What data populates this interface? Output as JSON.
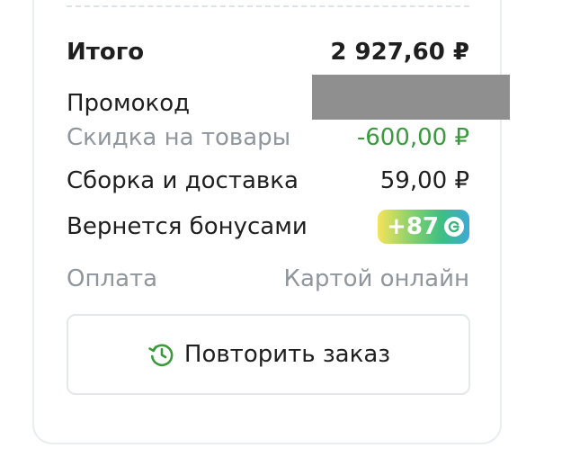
{
  "summary": {
    "total": {
      "label": "Итого",
      "value": "2 927,60 ₽"
    },
    "promo": {
      "label": "Промокод"
    },
    "discount": {
      "label": "Скидка на товары",
      "value": "-600,00 ₽"
    },
    "delivery": {
      "label": "Сборка и доставка",
      "value": "59,00 ₽"
    },
    "bonus": {
      "label": "Вернется бонусами",
      "value": "+87",
      "icon": "bonus-coin-icon"
    },
    "payment": {
      "label": "Оплата",
      "value": "Картой онлайн"
    }
  },
  "actions": {
    "repeat_label": "Повторить заказ",
    "repeat_icon": "history-icon"
  },
  "colors": {
    "discount": "#3a9a3c",
    "muted": "#8f969c",
    "redaction": "#8f8f8f"
  }
}
